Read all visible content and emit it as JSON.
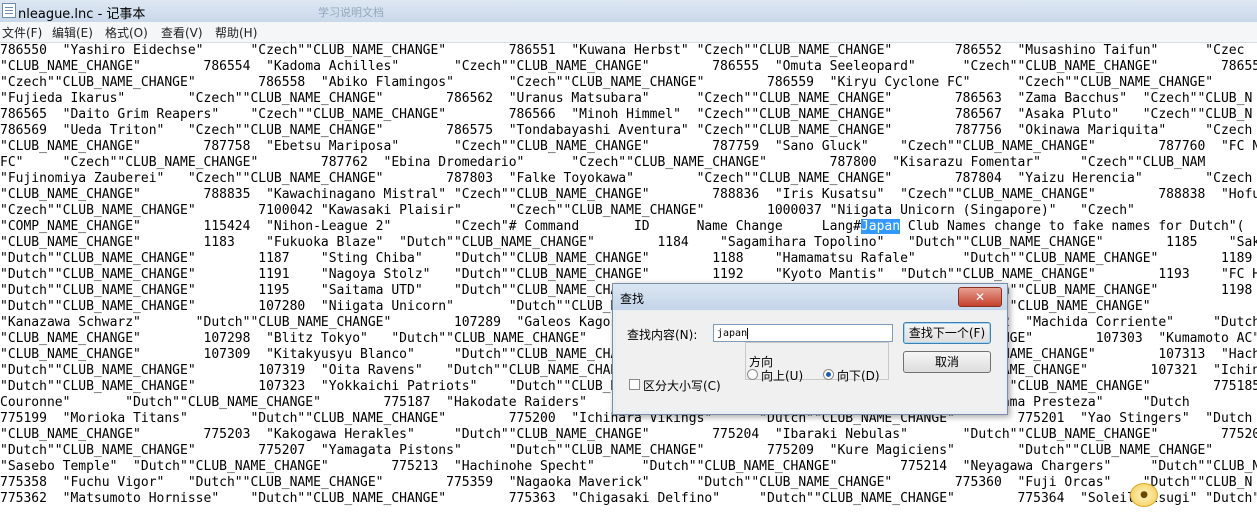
{
  "window": {
    "title": "nleague.lnc - 记事本",
    "ghost_tabs": [
      "学习说明文档",
      "",
      ""
    ]
  },
  "menu": [
    "文件(F)",
    "编辑(E)",
    "格式(O)",
    "查看(V)",
    "帮助(H)"
  ],
  "editor": {
    "lines": [
      "786550  \"Yashiro Eidechse\"      \"Czech\"\"CLUB_NAME_CHANGE\"        786551  \"Kuwana Herbst\" \"Czech\"\"CLUB_NAME_CHANGE\"        786552  \"Musashino Taifun\"      \"Czec",
      "\"CLUB_NAME_CHANGE\"        786554  \"Kadoma Achilles\"       \"Czech\"\"CLUB_NAME_CHANGE\"        786555  \"Omuta Seeleopard\"      \"Czech\"\"CLUB_NAME_CHANGE\"        78655",
      "\"Czech\"\"CLUB_NAME_CHANGE\"        786558  \"Abiko Flamingos\"       \"Czech\"\"CLUB_NAME_CHANGE\"        786559  \"Kiryu Cyclone FC\"      \"Czech\"\"CLUB_NAME_CHANGE\"",
      "\"Fujieda Ikarus\"        \"Czech\"\"CLUB_NAME_CHANGE\"        786562  \"Uranus Matsubara\"      \"Czech\"\"CLUB_NAME_CHANGE\"        786563  \"Zama Bacchus\"  \"Czech\"\"CLUB_N",
      "786565  \"Daito Grim Reapers\"    \"Czech\"\"CLUB_NAME_CHANGE\"        786566  \"Minoh Himmel\"  \"Czech\"\"CLUB_NAME_CHANGE\"        786567  \"Asaka Pluto\"   \"Czech\"\"CLUB_N",
      "786569  \"Ueda Triton\"   \"Czech\"\"CLUB_NAME_CHANGE\"        786575  \"Tondabayashi Aventura\" \"Czech\"\"CLUB_NAME_CHANGE\"        787756  \"Okinawa Mariquita\"     \"Czech",
      "\"CLUB_NAME_CHANGE\"        787758  \"Ebetsu Mariposa\"       \"Czech\"\"CLUB_NAME_CHANGE\"        787759  \"Sano Gluck\"    \"Czech\"\"CLUB_NAME_CHANGE\"        787760  \"FC Ni",
      "FC\"     \"Czech\"\"CLUB_NAME_CHANGE\"        787762  \"Ebina Dromedario\"      \"Czech\"\"CLUB_NAME_CHANGE\"        787800  \"Kisarazu Fomentar\"     \"Czech\"\"CLUB_NAM",
      "\"Fujinomiya Zauberei\"   \"Czech\"\"CLUB_NAME_CHANGE\"        787803  \"Falke Toyokawa\"        \"Czech\"\"CLUB_NAME_CHANGE\"        787804  \"Yaizu Herencia\"        \"Czech",
      "\"CLUB_NAME_CHANGE\"        788835  \"Kawachinagano Mistral\" \"Czech\"\"CLUB_NAME_CHANGE\"        788836  \"Iris Kusatsu\"  \"Czech\"\"CLUB_NAME_CHANGE\"        788838  \"Hofu",
      "\"Czech\"\"CLUB_NAME_CHANGE\"        7100042 \"Kawasaki Plaisir\"      \"Czech\"\"CLUB_NAME_CHANGE\"        1000037 \"Niigata Unicorn (Singapore)\"   \"Czech\"",
      "\"COMP_NAME_CHANGE\"        115424  \"Nihon-League 2\"        \"Czech\"# Command       ID      Name Change     Lang#Japan Club Names change to fake names for Dutch\"(",
      "\"CLUB_NAME_CHANGE\"        1183    \"Fukuoka Blaze\"  \"Dutch\"\"CLUB_NAME_CHANGE\"        1184    \"Sagamihara Topolino\"   \"Dutch\"\"CLUB_NAME_CHANGE\"        1185    \"Sakai",
      "\"Dutch\"\"CLUB_NAME_CHANGE\"        1187    \"Sting Chiba\"    \"Dutch\"\"CLUB_NAME_CHANGE\"        1188    \"Hamamatsu Rafale\"      \"Dutch\"\"CLUB_NAME_CHANGE\"        1189    \"Okaya",
      "\"Dutch\"\"CLUB_NAME_CHANGE\"        1191    \"Nagoya Stolz\"   \"Dutch\"\"CLUB_NAME_CHANGE\"        1192    \"Kyoto Mantis\"  \"Dutch\"\"CLUB_NAME_CHANGE\"        1193    \"FC Hi",
      "\"Dutch\"\"CLUB_NAME_CHANGE\"        1195    \"Saitama UTD\"    \"Dutch\"\"CLUB_NAME_CHANGE\"        1196    \"Tokyo Nova Pirla\"      \"Dutch\"\"CLUB_NAME_CHANGE\"        1198",
      "\"Dutch\"\"CLUB_NAME_CHANGE\"        107280  \"Niigata Unicorn\"       \"Dutch\"\"CLUB_NAME_CHANGE\"        107281  \"Nara Pirata\"   \"Dutch\"\"CLUB_NAME_CHANGE\"",
      "\"Kanazawa Schwarz\"       \"Dutch\"\"CLUB_NAME_CHANGE\"        107289  \"Galeos Kagoshima\"      \"Dutch\"\"CLUB_NAME_CHANGE\"        107292  \"Machida Corriente\"     \"Dutch",
      "\"CLUB_NAME_CHANGE\"        107298  \"Blitz Tokyo\"   \"Dutch\"\"CLUB_NAME_CHANGE\"        107299  \"Sendai Gemini\" \"Dutch\"\"CLUB_NAME_CHANGE\"        107303  \"Kumamoto AC\"",
      "\"CLUB_NAME_CHANGE\"        107309  \"Kitakyusyu Blanco\"     \"Dutch\"\"CLUB_NAME_CHANGE\"        107310  \"Tochigi Rosso\" \"Dutch\"\"CLUB_NAME_CHANGE\"        107313  \"Hachi",
      "\"Dutch\"\"CLUB_NAME_CHANGE\"        107319  \"Oita Ravens\"   \"Dutch\"\"CLUB_NAME_CHANGE\"        107320  \"Gifu Sparks\"   \"Dutch\"\"CLUB_NAME_CHANGE\"        107321  \"Ichin",
      "\"Dutch\"\"CLUB_NAME_CHANGE\"        107323  \"Yokkaichi Patriots\"    \"Dutch\"\"CLUB_NAME_CHANGE\"        107325  \"Ehime Leone\"   \"Dutch\"\"CLUB_NAME_CHANGE\"        775185",
      "Couronne\"       \"Dutch\"\"CLUB_NAME_CHANGE\"        775187  \"Hakodate Raiders\"      \"Dutch\"\"CLUB_NAME_CHANGE\"        775188  \"Wakayama Presteza\"     \"Dutch",
      "775199  \"Morioka Titans\"        \"Dutch\"\"CLUB_NAME_CHANGE\"        775200  \"Ichihara Vikings\"      \"Dutch\"\"CLUB_NAME_CHANGE\"        775201  \"Yao Stingers\"  \"Dutch",
      "\"CLUB_NAME_CHANGE\"        775203  \"Kakogawa Herakles\"     \"Dutch\"\"CLUB_NAME_CHANGE\"        775204  \"Ibaraki Nebulas\"       \"Dutch\"\"CLUB_NAME_CHANGE\"        775205",
      "\"Dutch\"\"CLUB_NAME_CHANGE\"        775207  \"Yamagata Pistons\"      \"Dutch\"\"CLUB_NAME_CHANGE\"        775209  \"Kure Magiciens\"        \"Dutch\"\"CLUB_NAME_CHANGE\"",
      "\"Sasebo Temple\"  \"Dutch\"\"CLUB_NAME_CHANGE\"        775213  \"Hachinohe Specht\"      \"Dutch\"\"CLUB_NAME_CHANGE\"        775214  \"Neyagawa Chargers\"     \"Dutch\"\"CLUB_N",
      "775358  \"Fuchu Vigor\"   \"Dutch\"\"CLUB_NAME_CHANGE\"        775359  \"Nagaoka Maverick\"      \"Dutch\"\"CLUB_NAME_CHANGE\"        775360  \"Fuji Orcas\"    \"Dutch\"\"CLUB_N",
      "775362  \"Matsumoto Hornisse\"    \"Dutch\"\"CLUB_NAME_CHANGE\"        775363  \"Chigasaki Delfino\"     \"Dutch\"\"CLUB_NAME_CHANGE\"        775364  \"Soleil Atsugi\" \"Dutch\"\"CLUB_N"
    ],
    "highlight": {
      "line": 11,
      "text": "Japan"
    }
  },
  "find_dialog": {
    "title": "查找",
    "close_label": "✕",
    "find_label": "查找内容(N):",
    "find_value": "japan",
    "find_next_label": "查找下一个(F)",
    "cancel_label": "取消",
    "direction_label": "方向",
    "up_label": "向上(U)",
    "down_label": "向下(D)",
    "direction_selected": "down",
    "match_case_label": "区分大小写(C)",
    "match_case_checked": false
  },
  "tray_icon": "sync-icon"
}
